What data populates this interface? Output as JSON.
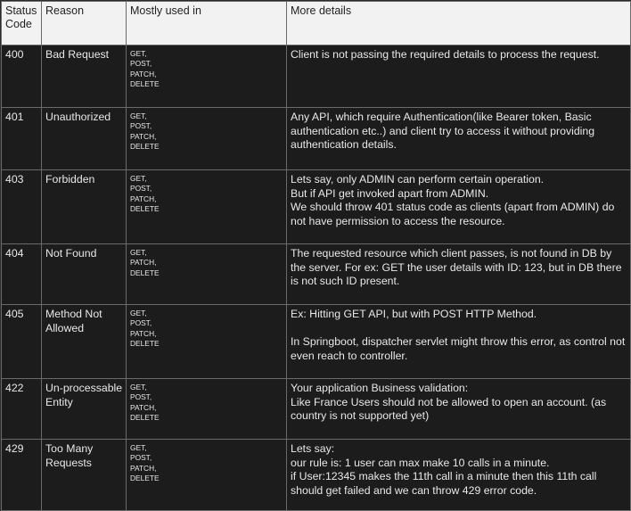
{
  "table": {
    "headers": {
      "status_code": "Status Code",
      "reason": "Reason",
      "mostly_used_in": "Mostly used in",
      "more_details": "More details"
    },
    "rows": [
      {
        "code": "400",
        "reason": "Bad Request",
        "methods": [
          "GET,",
          "POST,",
          "PATCH,",
          "DELETE"
        ],
        "details": [
          "Client is not passing the required details to process the request."
        ]
      },
      {
        "code": "401",
        "reason": "Unauthorized",
        "methods": [
          "GET,",
          "POST,",
          "PATCH,",
          "DELETE"
        ],
        "details": [
          "Any API, which require Authentication(like Bearer token, Basic authentication etc..) and client try to access it without providing authentication details."
        ]
      },
      {
        "code": "403",
        "reason": "Forbidden",
        "methods": [
          "GET,",
          "POST,",
          "PATCH,",
          "DELETE"
        ],
        "details": [
          "Lets say, only ADMIN can perform certain operation.",
          "But if API get invoked apart from ADMIN.",
          "We should throw 401 status code as clients (apart from ADMIN) do not have permission to access the resource."
        ]
      },
      {
        "code": "404",
        "reason": "Not Found",
        "methods": [
          "GET,",
          "PATCH,",
          "DELETE"
        ],
        "details": [
          "The requested resource which client passes, is not found in DB by the server. For ex: GET the user details with ID: 123, but in DB there is not such ID present."
        ]
      },
      {
        "code": "405",
        "reason": "Method Not Allowed",
        "methods": [
          "GET,",
          "POST,",
          "PATCH,",
          "DELETE"
        ],
        "details": [
          "Ex: Hitting GET API, but with POST HTTP Method.",
          "",
          "In Springboot, dispatcher servlet might throw this error, as control not even reach to controller."
        ]
      },
      {
        "code": "422",
        "reason": "Un-processable Entity",
        "methods": [
          "GET,",
          "POST,",
          "PATCH,",
          "DELETE"
        ],
        "details": [
          "Your application Business validation:",
          "Like France Users should not be allowed to open an account. (as country is not supported yet)"
        ]
      },
      {
        "code": "429",
        "reason": "Too Many Requests",
        "methods": [
          "GET,",
          "POST,",
          "PATCH,",
          "DELETE"
        ],
        "details": [
          "Lets say:",
          "our rule is: 1 user can max make 10 calls in a minute.",
          "if User:12345 makes the 11th call in a minute then this 11th call should get failed and we can throw 429 error code."
        ]
      }
    ]
  }
}
